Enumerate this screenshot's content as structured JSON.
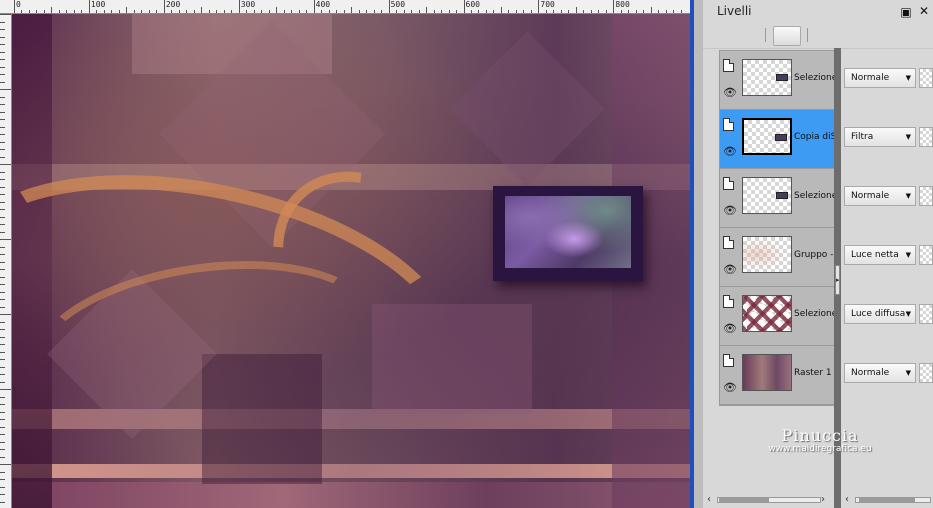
{
  "ruler": {
    "labels": [
      "0",
      "100",
      "200",
      "300",
      "400",
      "500",
      "600",
      "700",
      "800"
    ]
  },
  "panel": {
    "title": "Livelli",
    "menu_icon": "menu-square-icon",
    "close_icon": "close-icon"
  },
  "layers": [
    {
      "name": "Selezione",
      "blend": "Normale",
      "selected": false,
      "thumb": "mark"
    },
    {
      "name": "Copia diS",
      "blend": "Filtra",
      "selected": true,
      "thumb": "mark"
    },
    {
      "name": "Selezione",
      "blend": "Normale",
      "selected": false,
      "thumb": "mark"
    },
    {
      "name": "Gruppo -",
      "blend": "Luce netta",
      "selected": false,
      "thumb": "group"
    },
    {
      "name": "Selezione",
      "blend": "Luce diffusa",
      "selected": false,
      "thumb": "diam"
    },
    {
      "name": "Raster 1",
      "blend": "Normale",
      "selected": false,
      "thumb": "raster"
    }
  ],
  "watermark": {
    "line1": "Pinuccia",
    "line2": "www.maidiregrafica.eu"
  },
  "colors": {
    "selected_row": "#3d9bf3",
    "panel_bg": "#d8d8d8",
    "canvas_border": "#1d4fc0"
  }
}
